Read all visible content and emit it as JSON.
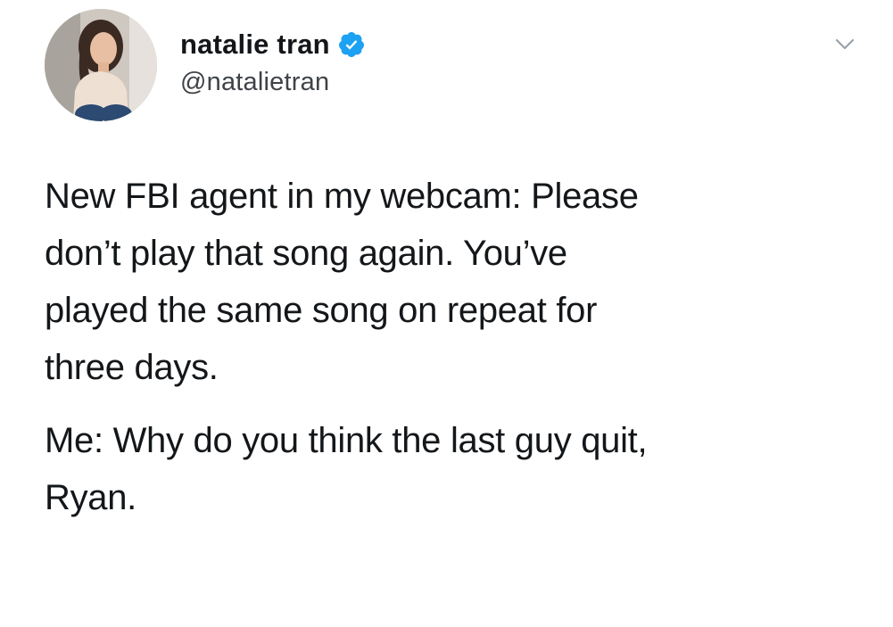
{
  "tweet": {
    "author": {
      "display_name": "natalie tran",
      "handle": "@natalietran",
      "verified": true,
      "avatar_icon": "avatar-photo"
    },
    "menu_icon": "chevron-down-icon",
    "paragraphs": [
      "New FBI agent in my webcam: Please\ndon’t play that song again. You’ve\nplayed the same song on repeat for\nthree days.",
      "Me: Why do you think the last guy quit,\nRyan."
    ]
  },
  "colors": {
    "text": "#14171a",
    "secondary_text": "#3f4347",
    "verified_badge": "#1da1f2",
    "background": "#ffffff"
  }
}
